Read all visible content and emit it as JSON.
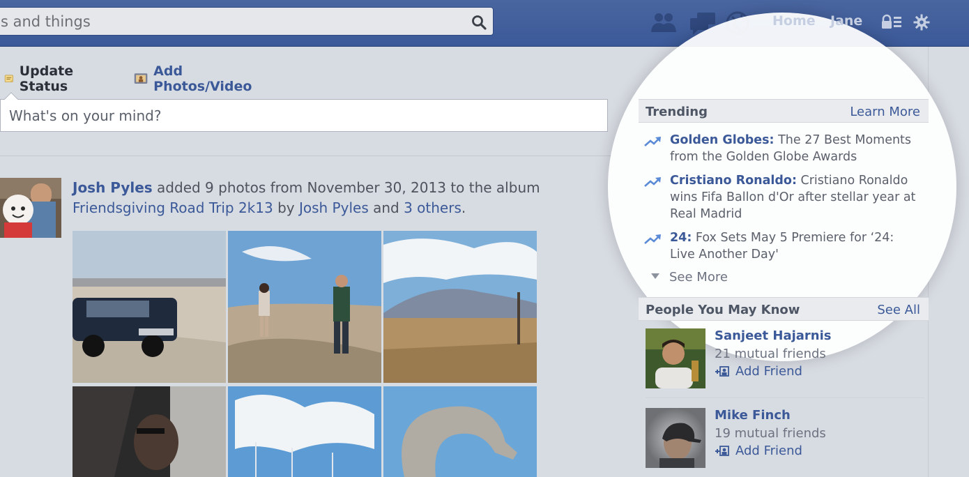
{
  "search": {
    "placeholder": "s and things",
    "icon": "magnifier-icon"
  },
  "topnav": {
    "icons": [
      "friend-requests-icon",
      "messages-icon",
      "notifications-globe-icon"
    ],
    "home_label": "Home",
    "user_label": "Jane",
    "privacy_icon": "privacy-lock-icon",
    "settings_icon": "gear-icon"
  },
  "composer": {
    "update_status_label": "Update Status",
    "add_photos_label": "Add Photos/Video",
    "placeholder": "What's on your mind?"
  },
  "story": {
    "actor": "Josh Pyles",
    "text_1": " added 9 photos from November 30, 2013 to the album ",
    "album": "Friendsgiving Road Trip 2k13",
    "text_2": " by ",
    "author": "Josh Pyles",
    "text_3": " and ",
    "others": "3 others",
    "text_4": "."
  },
  "trending": {
    "title": "Trending",
    "action": "Learn More",
    "items": [
      {
        "topic": "Golden Globes:",
        "headline": " The 27 Best Moments from the Golden Globe Awards"
      },
      {
        "topic": "Cristiano Ronaldo:",
        "headline": " Cristiano Ronaldo wins Fifa Ballon d'Or after stellar year at Real Madrid"
      },
      {
        "topic": "24:",
        "headline": " Fox Sets May 5 Premiere for ‘24: Live Another Day'"
      }
    ],
    "see_more": "See More"
  },
  "people": {
    "title": "People You May Know",
    "action": "See All",
    "items": [
      {
        "name": "Sanjeet Hajarnis",
        "mutual": "21 mutual friends",
        "add": "Add Friend"
      },
      {
        "name": "Mike Finch",
        "mutual": "19 mutual friends",
        "add": "Add Friend"
      }
    ]
  },
  "colors": {
    "brand_blue": "#3b5998",
    "link_blue": "#3b5998",
    "trend_arrow": "#5b8bd6"
  }
}
